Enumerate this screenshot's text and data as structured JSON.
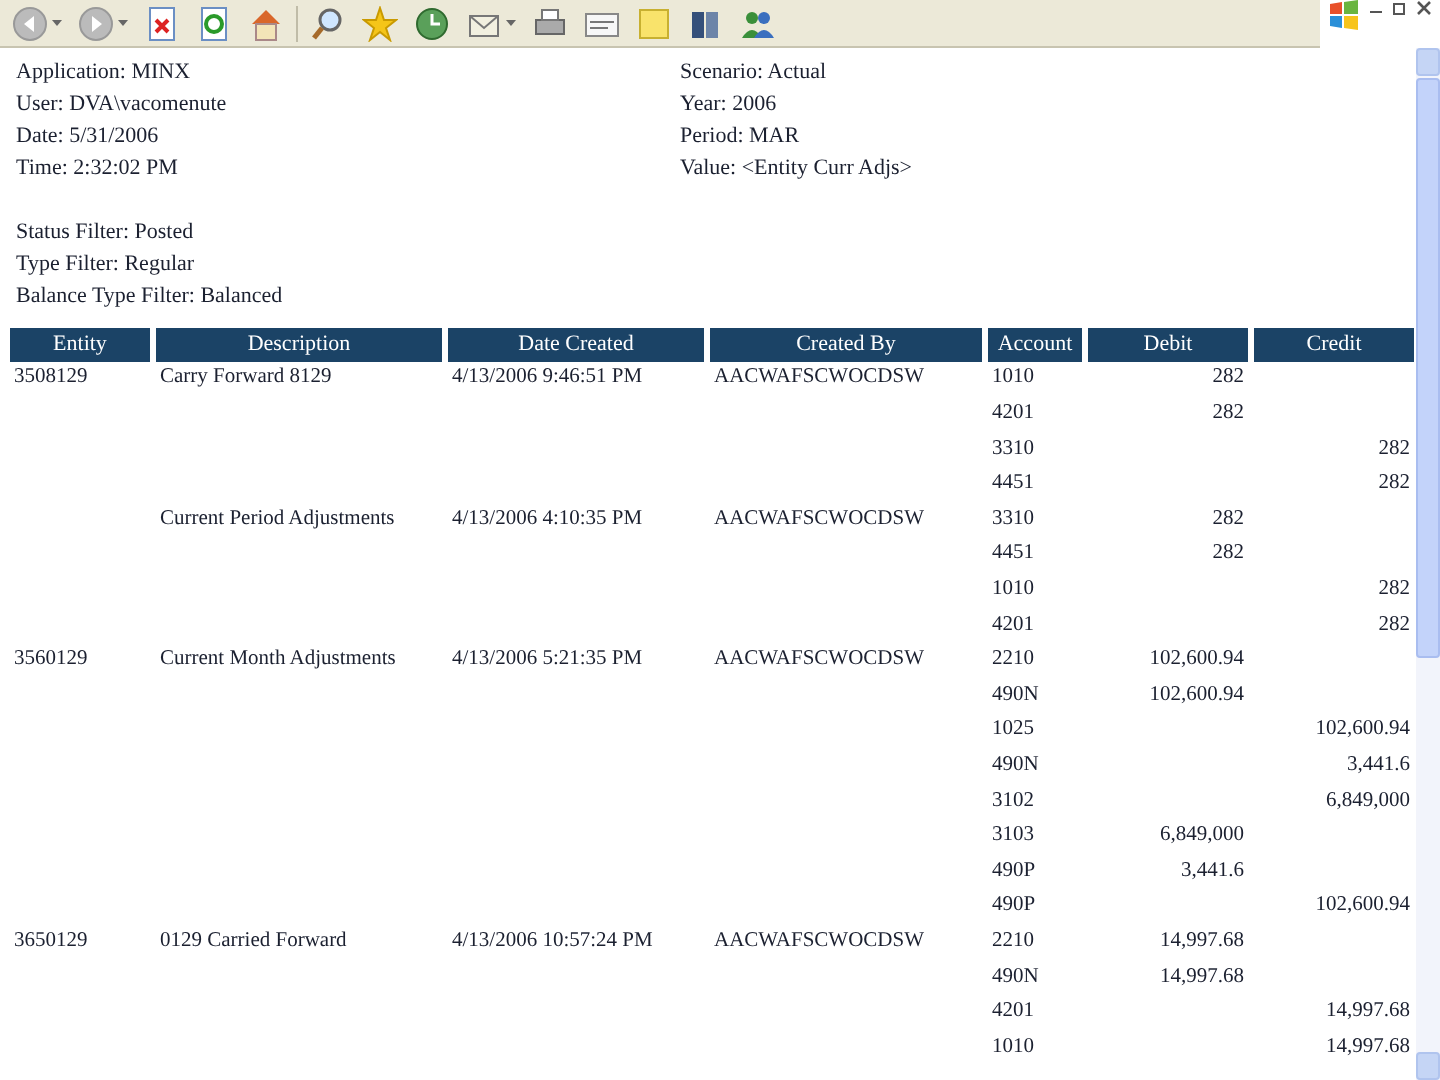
{
  "header_left": [
    "Application: MINX",
    "User: DVA\\vacomenute",
    "Date: 5/31/2006",
    "Time: 2:32:02 PM"
  ],
  "header_right": [
    "Scenario: Actual",
    "Year: 2006",
    "Period: MAR",
    "Value: <Entity Curr Adjs>"
  ],
  "filters": [
    "Status Filter: Posted",
    "Type Filter: Regular",
    "Balance Type Filter: Balanced"
  ],
  "table": {
    "columns": [
      "Entity",
      "Description",
      "Date Created",
      "Created By",
      "Account",
      "Debit",
      "Credit"
    ],
    "rows": [
      {
        "entity": "3508129",
        "description": "Carry Forward 8129",
        "date_created": "4/13/2006 9:46:51 PM",
        "created_by": "AACWAFSCWOCDSW",
        "account": "1010",
        "debit": "282"
      },
      {
        "account": "4201",
        "debit": "282"
      },
      {
        "account": "3310",
        "credit": "282"
      },
      {
        "account": "4451",
        "credit": "282"
      },
      {
        "description": "Current Period Adjustments",
        "date_created": "4/13/2006 4:10:35 PM",
        "created_by": "AACWAFSCWOCDSW",
        "account": "3310",
        "debit": "282"
      },
      {
        "account": "4451",
        "debit": "282"
      },
      {
        "account": "1010",
        "credit": "282"
      },
      {
        "account": "4201",
        "credit": "282"
      },
      {
        "entity": "3560129",
        "description": "Current Month Adjustments",
        "date_created": "4/13/2006 5:21:35 PM",
        "created_by": "AACWAFSCWOCDSW",
        "account": "2210",
        "debit": "102,600.94"
      },
      {
        "account": "490N",
        "debit": "102,600.94"
      },
      {
        "account": "1025",
        "credit": "102,600.94"
      },
      {
        "account": "490N",
        "credit": "3,441.6"
      },
      {
        "account": "3102",
        "credit": "6,849,000"
      },
      {
        "account": "3103",
        "debit": "6,849,000"
      },
      {
        "account": "490P",
        "debit": "3,441.6"
      },
      {
        "account": "490P",
        "credit": "102,600.94"
      },
      {
        "entity": "3650129",
        "description": "0129 Carried Forward",
        "date_created": "4/13/2006 10:57:24 PM",
        "created_by": "AACWAFSCWOCDSW",
        "account": "2210",
        "debit": "14,997.68"
      },
      {
        "account": "490N",
        "debit": "14,997.68"
      },
      {
        "account": "4201",
        "credit": "14,997.68"
      },
      {
        "account": "1010",
        "credit": "14,997.68"
      }
    ]
  }
}
